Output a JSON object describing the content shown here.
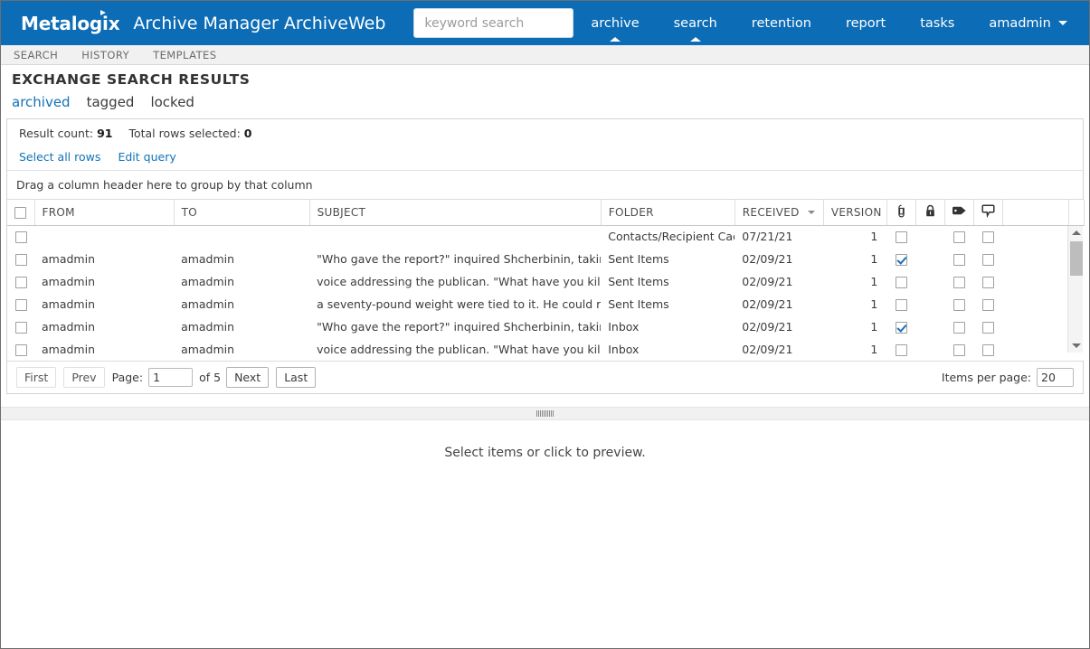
{
  "header": {
    "brand": "Metalogix",
    "app_title": "Archive Manager ArchiveWeb",
    "search_placeholder": "keyword search",
    "search_value": "",
    "nav": [
      {
        "label": "archive",
        "active": false,
        "caret": false
      },
      {
        "label": "search",
        "active": true,
        "caret": false
      },
      {
        "label": "retention",
        "active": false,
        "caret": false
      },
      {
        "label": "report",
        "active": false,
        "caret": false
      },
      {
        "label": "tasks",
        "active": false,
        "caret": false
      },
      {
        "label": "amadmin",
        "active": false,
        "caret": true
      }
    ],
    "accent_color": "#0c6cb5"
  },
  "subnav": {
    "items": [
      {
        "label": "SEARCH"
      },
      {
        "label": "HISTORY"
      },
      {
        "label": "TEMPLATES"
      }
    ]
  },
  "page": {
    "title": "EXCHANGE SEARCH RESULTS",
    "state_tabs": [
      {
        "label": "archived",
        "selected": true
      },
      {
        "label": "tagged",
        "selected": false
      },
      {
        "label": "locked",
        "selected": false
      }
    ]
  },
  "results": {
    "result_count_label": "Result count:",
    "result_count_value": "91",
    "rows_selected_label": "Total rows selected:",
    "rows_selected_value": "0",
    "select_all_link": "Select all rows",
    "edit_query_link": "Edit query",
    "group_hint": "Drag a column header here to group by that column"
  },
  "grid": {
    "columns": [
      {
        "key": "select",
        "label": "",
        "icon": "checkbox-icon"
      },
      {
        "key": "from",
        "label": "FROM"
      },
      {
        "key": "to",
        "label": "TO"
      },
      {
        "key": "subject",
        "label": "SUBJECT"
      },
      {
        "key": "folder",
        "label": "FOLDER"
      },
      {
        "key": "received",
        "label": "RECEIVED",
        "sorted": true
      },
      {
        "key": "version",
        "label": "VERSION"
      },
      {
        "key": "attachment",
        "label": "",
        "icon": "paperclip-icon"
      },
      {
        "key": "locked",
        "label": "",
        "icon": "lock-icon"
      },
      {
        "key": "tagged",
        "label": "",
        "icon": "tag-icon"
      },
      {
        "key": "comment",
        "label": "",
        "icon": "comment-icon"
      },
      {
        "key": "spacer",
        "label": ""
      }
    ],
    "rows": [
      {
        "selected": false,
        "from": "",
        "to": "",
        "subject": "",
        "folder": "Contacts/Recipient Cache",
        "received": "07/21/21",
        "version": "1",
        "attachment": false,
        "tagged": false,
        "comment": false
      },
      {
        "selected": false,
        "from": "amadmin",
        "to": "amadmin",
        "subject": "\"Who gave the report?\" inquired Shcherbinin, taking the ...",
        "folder": "Sent Items",
        "received": "02/09/21",
        "version": "1",
        "attachment": true,
        "tagged": false,
        "comment": false
      },
      {
        "selected": false,
        "from": "amadmin",
        "to": "amadmin",
        "subject": "voice addressing the publican. \"What have you killed a ...",
        "folder": "Sent Items",
        "received": "02/09/21",
        "version": "1",
        "attachment": false,
        "tagged": false,
        "comment": false
      },
      {
        "selected": false,
        "from": "amadmin",
        "to": "amadmin",
        "subject": "a seventy-pound weight were tied to it. He could run no ...",
        "folder": "Sent Items",
        "received": "02/09/21",
        "version": "1",
        "attachment": false,
        "tagged": false,
        "comment": false
      },
      {
        "selected": false,
        "from": "amadmin",
        "to": "amadmin",
        "subject": "\"Who gave the report?\" inquired Shcherbinin, taking the ...",
        "folder": "Inbox",
        "received": "02/09/21",
        "version": "1",
        "attachment": true,
        "tagged": false,
        "comment": false
      },
      {
        "selected": false,
        "from": "amadmin",
        "to": "amadmin",
        "subject": "voice addressing the publican. \"What have you killed a ...",
        "folder": "Inbox",
        "received": "02/09/21",
        "version": "1",
        "attachment": false,
        "tagged": false,
        "comment": false
      }
    ]
  },
  "pager": {
    "first": "First",
    "prev": "Prev",
    "page_label": "Page:",
    "page_value": "1",
    "of_label": "of 5",
    "next": "Next",
    "last": "Last",
    "items_per_page_label": "Items per page:",
    "items_per_page_value": "20"
  },
  "preview": {
    "empty_text": "Select items or click to preview."
  }
}
